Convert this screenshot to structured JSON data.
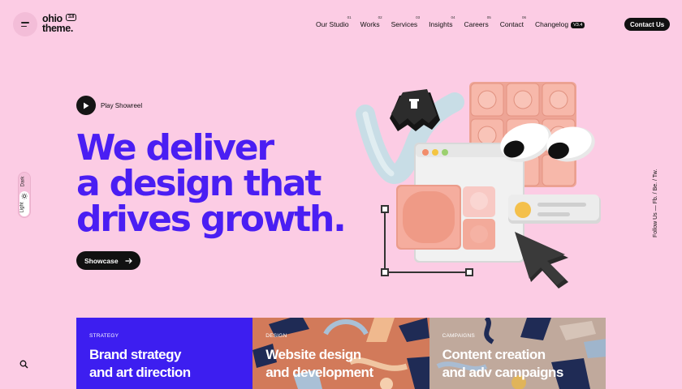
{
  "header": {
    "logo_line1": "ohio",
    "logo_badge": "3.8",
    "logo_line2": "theme.",
    "nav": [
      {
        "label": "Our Studio",
        "num": "01"
      },
      {
        "label": "Works",
        "num": "02"
      },
      {
        "label": "Services",
        "num": "03"
      },
      {
        "label": "Insights",
        "num": "04"
      },
      {
        "label": "Careers",
        "num": "05"
      },
      {
        "label": "Contact",
        "num": "06"
      }
    ],
    "changelog_label": "Changelog",
    "changelog_version": "V3.4",
    "contact_button": "Contact Us"
  },
  "hero": {
    "play_label": "Play Showreel",
    "headline": [
      "We deliver",
      "a design that",
      "drives growth."
    ],
    "showcase_button": "Showcase"
  },
  "theme_switch": {
    "dark": "Dark",
    "light": "Light"
  },
  "follow": "Follow Us  —  Fb. / Be. / Tw.",
  "cards": [
    {
      "label": "STRATEGY",
      "title1": "Brand strategy",
      "title2": "and art direction",
      "bg": "#3d1ef0"
    },
    {
      "label": "DESIGN",
      "title1": "Website design",
      "title2": "and development",
      "bg": "#d27a5a"
    },
    {
      "label": "CAMPAIGNS",
      "title1": "Content creation",
      "title2": "and adv campaigns",
      "bg": "#c0a99c"
    }
  ],
  "colors": {
    "background": "#fccce4",
    "accent": "#4a1ef3",
    "dark": "#111111"
  },
  "icons": [
    "menu-icon",
    "play-icon",
    "arrow-right-icon",
    "sun-icon",
    "search-icon"
  ]
}
